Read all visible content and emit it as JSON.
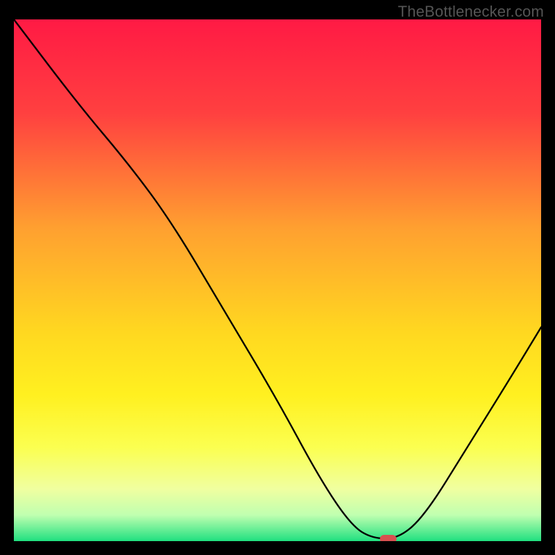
{
  "watermark": "TheBottlenecker.com",
  "chart_data": {
    "type": "line",
    "title": "",
    "xlabel": "",
    "ylabel": "",
    "xlim": [
      0,
      100
    ],
    "ylim": [
      0,
      100
    ],
    "background_gradient": {
      "stops": [
        {
          "offset": 0,
          "color": "#ff1a44"
        },
        {
          "offset": 18,
          "color": "#ff4040"
        },
        {
          "offset": 40,
          "color": "#ffa030"
        },
        {
          "offset": 60,
          "color": "#ffd820"
        },
        {
          "offset": 72,
          "color": "#fff020"
        },
        {
          "offset": 82,
          "color": "#fbff50"
        },
        {
          "offset": 90,
          "color": "#f0ffa0"
        },
        {
          "offset": 95,
          "color": "#c0ffb0"
        },
        {
          "offset": 100,
          "color": "#20e080"
        }
      ]
    },
    "curve": [
      {
        "x": 0,
        "y": 100
      },
      {
        "x": 12,
        "y": 84
      },
      {
        "x": 22,
        "y": 72
      },
      {
        "x": 30,
        "y": 61
      },
      {
        "x": 40,
        "y": 44
      },
      {
        "x": 50,
        "y": 27
      },
      {
        "x": 58,
        "y": 12
      },
      {
        "x": 64,
        "y": 3
      },
      {
        "x": 68,
        "y": 0.5
      },
      {
        "x": 73,
        "y": 0.5
      },
      {
        "x": 78,
        "y": 5
      },
      {
        "x": 86,
        "y": 18
      },
      {
        "x": 94,
        "y": 31
      },
      {
        "x": 100,
        "y": 41
      }
    ],
    "marker": {
      "x": 71,
      "y": 0,
      "color": "#d85050",
      "rx": 12,
      "ry": 6
    }
  }
}
